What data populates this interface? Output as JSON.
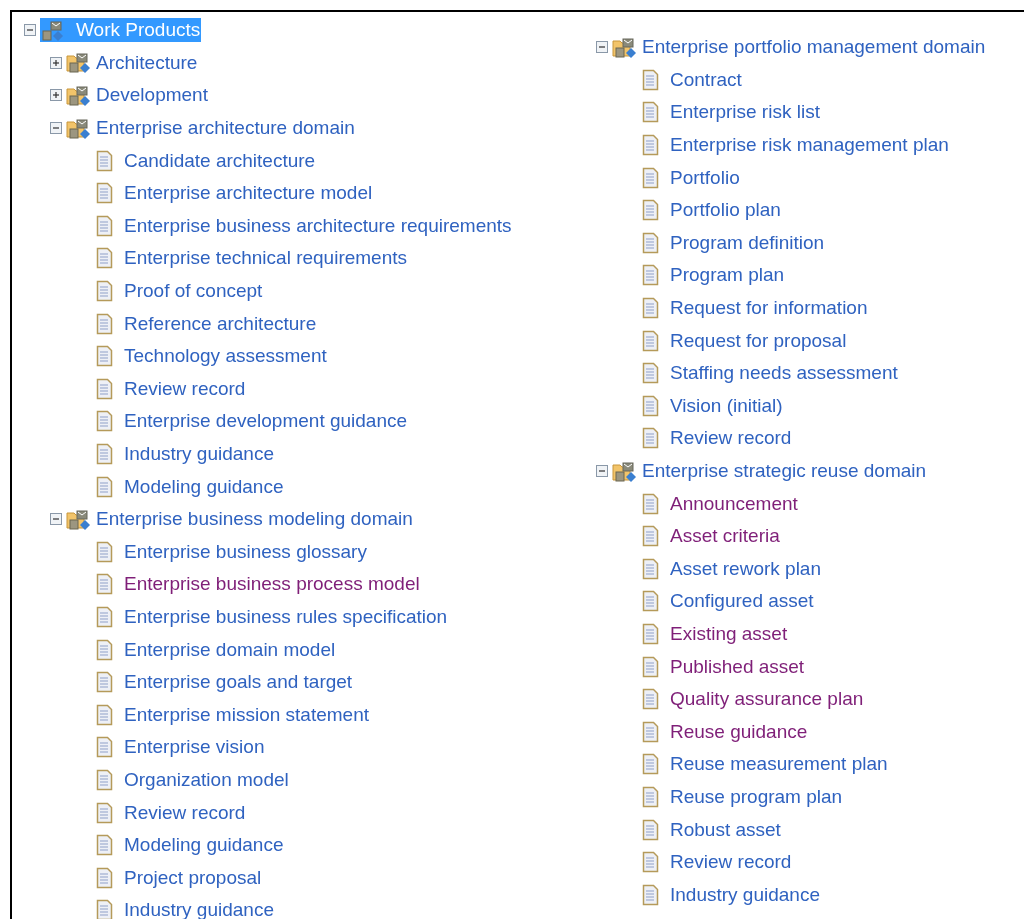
{
  "left_column": {
    "label": "Work Products",
    "selected": true,
    "expanded": true,
    "children": [
      {
        "label": "Architecture",
        "expanded": false
      },
      {
        "label": "Development",
        "expanded": false
      },
      {
        "label": "Enterprise architecture domain",
        "expanded": true,
        "children": [
          {
            "label": "Candidate architecture",
            "visited": false
          },
          {
            "label": "Enterprise architecture model",
            "visited": false
          },
          {
            "label": "Enterprise business architecture requirements",
            "visited": false
          },
          {
            "label": "Enterprise technical requirements",
            "visited": false
          },
          {
            "label": "Proof of concept",
            "visited": false
          },
          {
            "label": "Reference architecture",
            "visited": false
          },
          {
            "label": "Technology assessment",
            "visited": false
          },
          {
            "label": "Review record",
            "visited": false
          },
          {
            "label": "Enterprise development guidance",
            "visited": false
          },
          {
            "label": "Industry guidance",
            "visited": false
          },
          {
            "label": "Modeling guidance",
            "visited": false
          }
        ]
      },
      {
        "label": "Enterprise business modeling domain",
        "expanded": true,
        "children": [
          {
            "label": "Enterprise business glossary",
            "visited": false
          },
          {
            "label": "Enterprise business process model",
            "visited": true
          },
          {
            "label": "Enterprise business rules specification",
            "visited": false
          },
          {
            "label": "Enterprise domain model",
            "visited": false
          },
          {
            "label": "Enterprise goals and target",
            "visited": false
          },
          {
            "label": "Enterprise mission statement",
            "visited": false
          },
          {
            "label": "Enterprise vision",
            "visited": false
          },
          {
            "label": "Organization model",
            "visited": false
          },
          {
            "label": "Review record",
            "visited": false
          },
          {
            "label": "Modeling guidance",
            "visited": false
          },
          {
            "label": "Project proposal",
            "visited": false
          },
          {
            "label": "Industry guidance",
            "visited": false
          }
        ]
      }
    ]
  },
  "right_column": [
    {
      "label": "Enterprise portfolio management domain",
      "expanded": true,
      "children": [
        {
          "label": "Contract",
          "visited": false
        },
        {
          "label": "Enterprise risk list",
          "visited": false
        },
        {
          "label": "Enterprise risk management plan",
          "visited": false
        },
        {
          "label": "Portfolio",
          "visited": false
        },
        {
          "label": "Portfolio plan",
          "visited": false
        },
        {
          "label": "Program definition",
          "visited": false
        },
        {
          "label": "Program plan",
          "visited": false
        },
        {
          "label": "Request for information",
          "visited": false
        },
        {
          "label": "Request for proposal",
          "visited": false
        },
        {
          "label": "Staffing needs assessment",
          "visited": false
        },
        {
          "label": "Vision (initial)",
          "visited": false
        },
        {
          "label": "Review record",
          "visited": false
        }
      ]
    },
    {
      "label": "Enterprise strategic reuse domain",
      "expanded": true,
      "children": [
        {
          "label": "Announcement",
          "visited": true
        },
        {
          "label": "Asset criteria",
          "visited": true
        },
        {
          "label": "Asset rework plan",
          "visited": false
        },
        {
          "label": "Configured asset",
          "visited": false
        },
        {
          "label": "Existing asset",
          "visited": true
        },
        {
          "label": "Published asset",
          "visited": true
        },
        {
          "label": "Quality assurance plan",
          "visited": true
        },
        {
          "label": "Reuse guidance",
          "visited": true
        },
        {
          "label": "Reuse measurement plan",
          "visited": false
        },
        {
          "label": "Reuse program plan",
          "visited": false
        },
        {
          "label": "Robust asset",
          "visited": false
        },
        {
          "label": "Review record",
          "visited": false
        },
        {
          "label": "Industry guidance",
          "visited": false
        }
      ]
    }
  ]
}
